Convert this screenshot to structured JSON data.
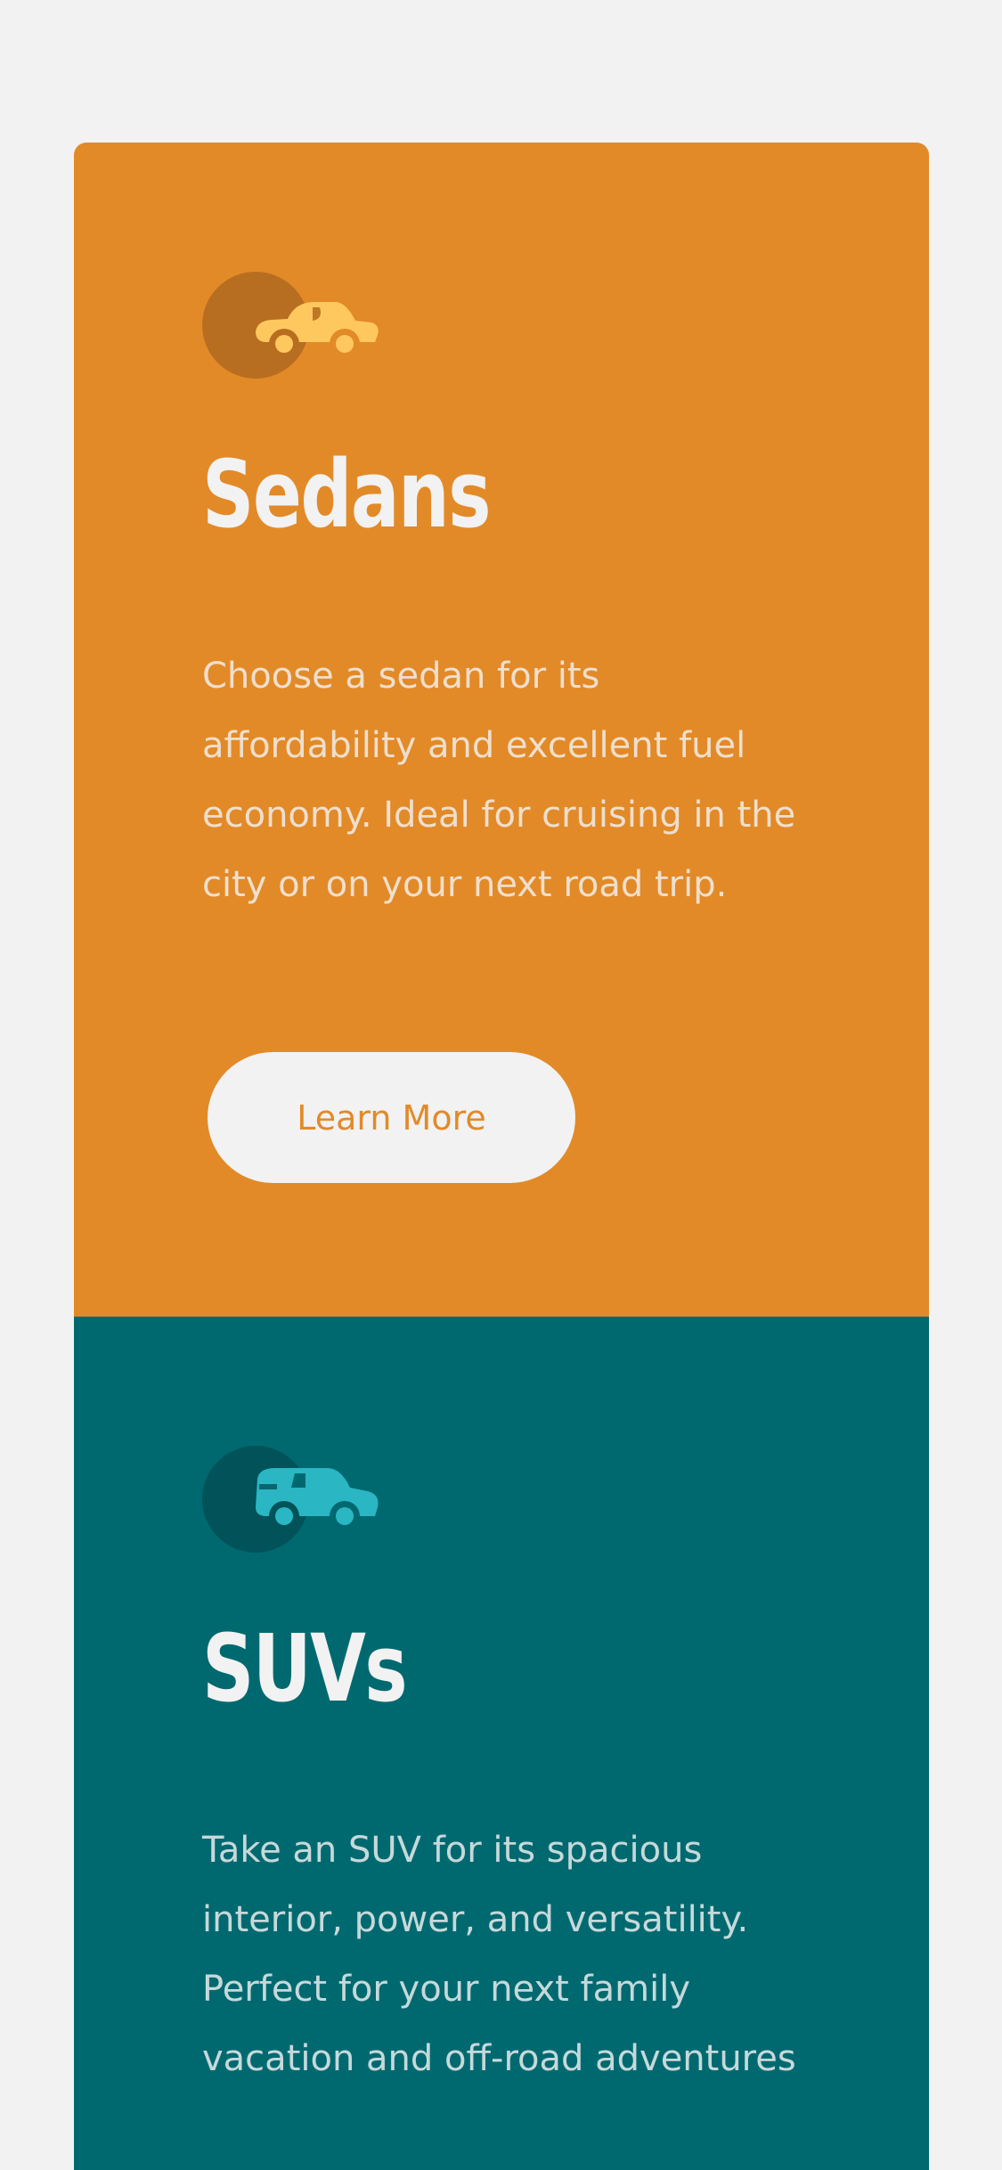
{
  "colors": {
    "page_background": "#f2f2f2",
    "sedans_background": "#e28a28",
    "suvs_background": "#006970",
    "text_light": "#f2f2f2",
    "sedan_icon": "#ffc85e",
    "sedan_icon_circle": "#b86e20",
    "suv_icon": "#2ab6c3",
    "suv_icon_circle": "#015259"
  },
  "cards": [
    {
      "id": "sedans",
      "icon": "sedan-car-icon",
      "title": "Sedans",
      "text": "Choose a sedan for its affordability and excellent fuel economy. Ideal for cruising in the city or on your next road trip.",
      "button_label": "Learn More"
    },
    {
      "id": "suvs",
      "icon": "suv-car-icon",
      "title": "SUVs",
      "text": "Take an SUV for its spacious interior, power, and versatility. Perfect for your next family vacation and off-road adventures"
    }
  ]
}
